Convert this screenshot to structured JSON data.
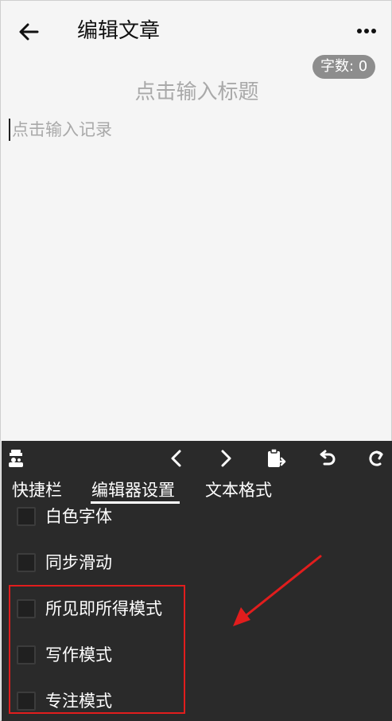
{
  "header": {
    "title": "编辑文章"
  },
  "editor": {
    "word_count": "字数: 0",
    "title_placeholder": "点击输入标题",
    "body_placeholder": "点击输入记录"
  },
  "toolbar": {
    "icons": [
      "robot-icon",
      "chevron-left-icon",
      "chevron-right-icon",
      "clipboard-icon",
      "undo-icon",
      "redo-icon"
    ]
  },
  "tabs": [
    {
      "label": "快捷栏"
    },
    {
      "label": "编辑器设置",
      "active": true
    },
    {
      "label": "文本格式"
    }
  ],
  "options": [
    {
      "label": "白色字体",
      "checked": false
    },
    {
      "label": "同步滑动",
      "checked": false
    },
    {
      "label": "所见即所得模式",
      "checked": false
    },
    {
      "label": "写作模式",
      "checked": false
    },
    {
      "label": "专注模式",
      "checked": false
    }
  ],
  "colors": {
    "panel_bg": "#2a2a2a",
    "annotation": "#e11d1d",
    "page_bg": "#f5f5f5"
  }
}
